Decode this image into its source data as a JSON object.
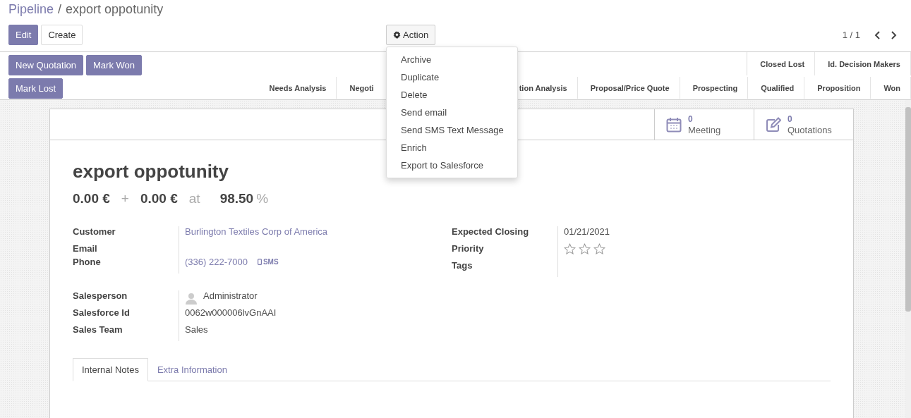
{
  "breadcrumb": {
    "parent": "Pipeline",
    "separator": "/",
    "current": "export oppotunity"
  },
  "buttons": [
    {
      "label": "Edit",
      "kind": "primary"
    },
    {
      "label": "Create",
      "kind": "secondary"
    }
  ],
  "action_menu": {
    "label": "Action",
    "expanded": true,
    "items": [
      "Archive",
      "Duplicate",
      "Delete",
      "Send email",
      "Send SMS Text Message",
      "Enrich",
      "Export to Salesforce"
    ]
  },
  "pager": "1 / 1",
  "status_buttons_top": [
    "New Quotation",
    "Mark Won"
  ],
  "status_buttons_bottom": [
    "Mark Lost"
  ],
  "stages_top": [
    "Closed Lost",
    "Id. Decision Makers"
  ],
  "stages_bottom": [
    "Needs Analysis",
    "Negoti",
    "tion Analysis",
    "Proposal/Price Quote",
    "Prospecting",
    "Qualified",
    "Proposition",
    "Won"
  ],
  "smart_buttons": [
    {
      "count": "0",
      "label": "Meeting",
      "kind": "calendar"
    },
    {
      "count": "0",
      "label": "Quotations",
      "kind": "edit"
    }
  ],
  "title": "export oppotunity",
  "amounts": {
    "expected": "0.00 €",
    "plus": "+",
    "prorated": "0.00 €",
    "at": "at",
    "probability": "98.50",
    "percent": "%"
  },
  "left_fields": [
    {
      "label": "Customer",
      "value": "Burlington Textiles Corp of America",
      "kind": "link"
    },
    {
      "label": "Email",
      "kind": "empty"
    },
    {
      "label": "Phone",
      "value": "(336) 222-7000",
      "kind": "phone",
      "action": "SMS"
    }
  ],
  "right_fields": [
    {
      "label": "Expected Closing",
      "value": "01/21/2021",
      "kind": "text"
    },
    {
      "label": "Priority",
      "kind": "stars",
      "stars": 0
    },
    {
      "label": "Tags",
      "kind": "empty"
    }
  ],
  "lower_fields": [
    {
      "label": "Salesperson",
      "value": "Administrator",
      "kind": "user"
    },
    {
      "label": "Salesforce Id",
      "value": "0062w000006lvGnAAI",
      "kind": "text"
    },
    {
      "label": "Sales Team",
      "value": "Sales",
      "kind": "text"
    }
  ],
  "tabs": [
    {
      "label": "Internal Notes",
      "selected": true
    },
    {
      "label": "Extra Information",
      "selected": false
    }
  ]
}
